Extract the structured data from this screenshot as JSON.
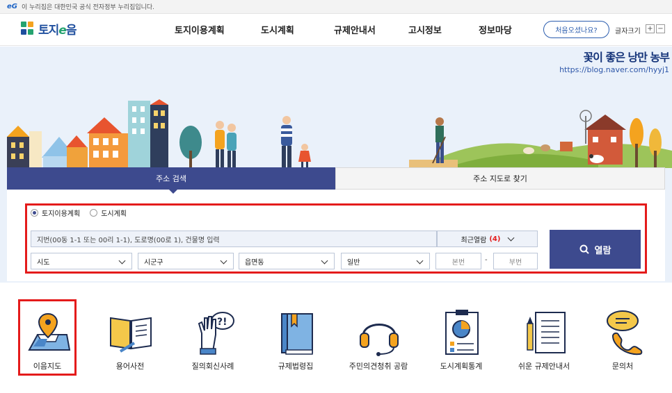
{
  "gov_banner": {
    "logo": "eG",
    "text": "이 누리집은 대한민국 공식 전자정부 누리집입니다."
  },
  "header": {
    "logo_text_1": "토지",
    "logo_text_e": "e",
    "logo_text_2": "음",
    "nav": [
      "토지이용계획",
      "도시계획",
      "규제안내서",
      "고시정보",
      "정보마당"
    ],
    "first_visit_label": "처음오셨나요?",
    "font_size_label": "글자크기",
    "font_plus": "+",
    "font_minus": "−"
  },
  "watermark": {
    "title": "꽃이 좋은 낭만 농부",
    "url": "https://blog.naver.com/hyyj1"
  },
  "search": {
    "tabs": [
      "주소 검색",
      "주소 지도로 찾기"
    ],
    "active_tab": 0,
    "radios": [
      {
        "label": "토지이용계획",
        "checked": true
      },
      {
        "label": "도시계획",
        "checked": false
      }
    ],
    "address_placeholder": "지번(00동 1-1 또는 00리 1-1), 도로명(00로 1), 건물명 입력",
    "recent_label": "최근열람",
    "recent_count": "(4)",
    "selects": [
      "시도",
      "시군구",
      "읍면동",
      "일반"
    ],
    "bonbeon_placeholder": "본번",
    "dash": "-",
    "bubeon_placeholder": "부번",
    "view_button": "열람"
  },
  "quick_menu": [
    {
      "label": "이음지도",
      "icon": "map-pin-icon",
      "highlighted": true
    },
    {
      "label": "용어사전",
      "icon": "open-book-icon",
      "highlighted": false
    },
    {
      "label": "질의회신사례",
      "icon": "raised-hand-question-icon",
      "highlighted": false
    },
    {
      "label": "규제법령집",
      "icon": "law-book-icon",
      "highlighted": false
    },
    {
      "label": "주민의견청취 공람",
      "icon": "headset-icon",
      "highlighted": false
    },
    {
      "label": "도시계획통계",
      "icon": "statistics-chart-icon",
      "highlighted": false
    },
    {
      "label": "쉬운 규제안내서",
      "icon": "guide-document-icon",
      "highlighted": false
    },
    {
      "label": "문의처",
      "icon": "chat-phone-icon",
      "highlighted": false
    }
  ],
  "colors": {
    "brand_navy": "#3d4a8e",
    "brand_blue": "#1f4f9e",
    "highlight_red": "#e41b1b",
    "hero_bg": "#eaf1fa"
  }
}
